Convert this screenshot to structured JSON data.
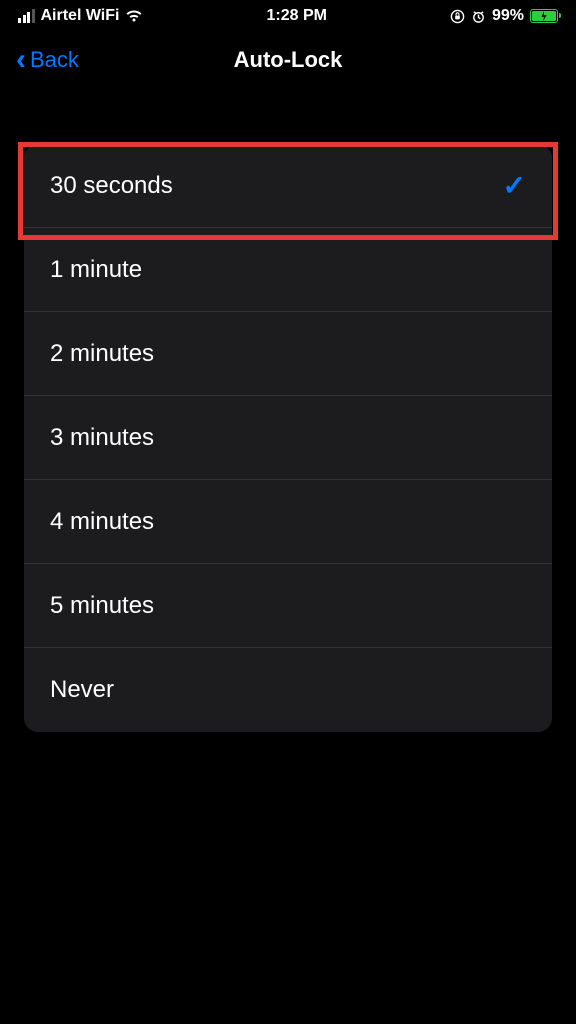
{
  "status": {
    "carrier": "Airtel WiFi",
    "time": "1:28 PM",
    "battery_pct": "99%"
  },
  "nav": {
    "back_label": "Back",
    "title": "Auto-Lock"
  },
  "options": [
    {
      "label": "30 seconds",
      "selected": true
    },
    {
      "label": "1 minute",
      "selected": false
    },
    {
      "label": "2 minutes",
      "selected": false
    },
    {
      "label": "3 minutes",
      "selected": false
    },
    {
      "label": "4 minutes",
      "selected": false
    },
    {
      "label": "5 minutes",
      "selected": false
    },
    {
      "label": "Never",
      "selected": false
    }
  ]
}
